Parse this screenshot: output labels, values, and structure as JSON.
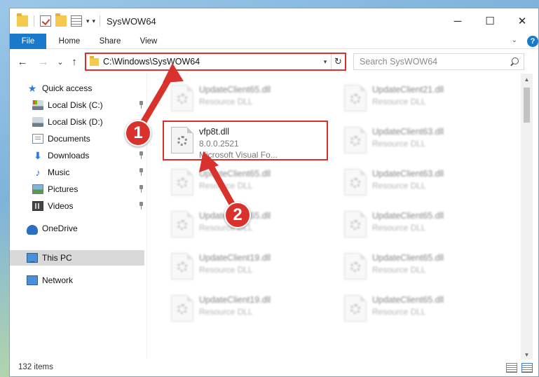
{
  "window": {
    "title": "SysWOW64",
    "controls": {
      "minimize": "─",
      "maximize": "☐",
      "close": "✕"
    }
  },
  "ribbon": {
    "tabs": [
      "File",
      "Home",
      "Share",
      "View"
    ],
    "help": "?"
  },
  "navigation": {
    "back": "←",
    "forward": "→",
    "recent": "⌄",
    "up": "↑",
    "address_path": "C:\\Windows\\SysWOW64",
    "refresh": "↻",
    "search_placeholder": "Search SysWOW64"
  },
  "sidebar": {
    "items": [
      {
        "label": "Quick access",
        "icon": "star-icon",
        "pinned": false
      },
      {
        "label": "Local Disk (C:)",
        "icon": "disk-icon",
        "pinned": true
      },
      {
        "label": "Local Disk (D:)",
        "icon": "disk-icon",
        "pinned": false
      },
      {
        "label": "Documents",
        "icon": "documents-icon",
        "pinned": false
      },
      {
        "label": "Downloads",
        "icon": "download-icon",
        "pinned": true
      },
      {
        "label": "Music",
        "icon": "music-icon",
        "pinned": true
      },
      {
        "label": "Pictures",
        "icon": "pictures-icon",
        "pinned": true
      },
      {
        "label": "Videos",
        "icon": "videos-icon",
        "pinned": true
      },
      {
        "label": "OneDrive",
        "icon": "onedrive-icon",
        "pinned": false
      },
      {
        "label": "This PC",
        "icon": "computer-icon",
        "pinned": false,
        "selected": true
      },
      {
        "label": "Network",
        "icon": "network-icon",
        "pinned": false
      }
    ]
  },
  "files": {
    "highlighted": {
      "name": "vfp8t.dll",
      "version": "8.0.0.2521",
      "description": "Microsoft Visual Fo..."
    },
    "blurred_tiles": [
      {
        "name": "UpdateClient65.dll",
        "type": "Resource DLL"
      },
      {
        "name": "UpdateClient21.dll",
        "type": "Resource DLL"
      },
      {
        "name": "UpdateClient63.dll",
        "type": "Resource DLL"
      },
      {
        "name": "UpdateClient65.dll",
        "type": "Resource DLL"
      },
      {
        "name": "UpdateClient63.dll",
        "type": "Resource DLL"
      },
      {
        "name": "UpdateClient65.dll",
        "type": "Resource DLL"
      },
      {
        "name": "UpdateClient65.dll",
        "type": "Resource DLL"
      },
      {
        "name": "UpdateClient19.dll",
        "type": "Resource DLL"
      },
      {
        "name": "UpdateClient65.dll",
        "type": "Resource DLL"
      },
      {
        "name": "UpdateClient19.dll",
        "type": "Resource DLL"
      },
      {
        "name": "UpdateClient65.dll",
        "type": "Resource DLL"
      }
    ]
  },
  "status": {
    "item_count": "132 items"
  },
  "annotations": {
    "step1": "1",
    "step2": "2",
    "color": "#d9312b"
  },
  "colors": {
    "accent": "#1979ca",
    "highlight_red": "#d9312b"
  }
}
